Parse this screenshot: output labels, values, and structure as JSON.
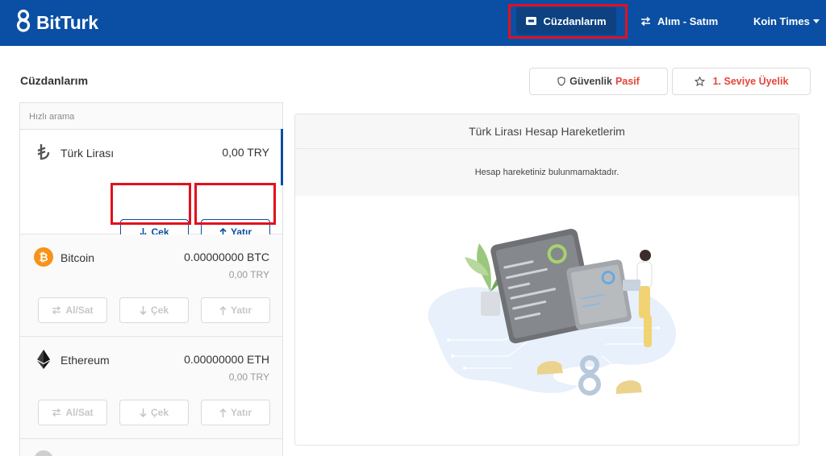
{
  "app": {
    "name": "BitTurk"
  },
  "nav": {
    "wallets": "Cüzdanlarım",
    "trade": "Alım - Satım",
    "koin_times": "Koin Times"
  },
  "page": {
    "title": "Cüzdanlarım",
    "security_label": "Güvenlik",
    "security_status": "Pasif",
    "level_label": "1. Seviye Üyelik"
  },
  "wallets": {
    "search_placeholder": "Hızlı arama",
    "items": [
      {
        "name": "Türk Lirası",
        "balance": "0,00 TRY",
        "sub": "",
        "withdraw": "Çek",
        "deposit": "Yatır",
        "trade": ""
      },
      {
        "name": "Bitcoin",
        "balance": "0.00000000 BTC",
        "sub": "0,00 TRY",
        "withdraw": "Çek",
        "deposit": "Yatır",
        "trade": "Al/Sat"
      },
      {
        "name": "Ethereum",
        "balance": "0.00000000 ETH",
        "sub": "0,00 TRY",
        "withdraw": "Çek",
        "deposit": "Yatır",
        "trade": "Al/Sat"
      }
    ]
  },
  "history": {
    "title": "Türk Lirası Hesap Hareketlerim",
    "empty_message": "Hesap hareketiniz bulunmamaktadır."
  },
  "colors": {
    "brand": "#0a4fa3",
    "highlight": "#e3101e",
    "bitcoin": "#f7931a",
    "accent_red": "#e5453a"
  },
  "icons": {
    "logo": "bitturk-logo-icon",
    "wallet": "wallet-icon",
    "transfer": "swap-arrows-icon",
    "shield": "shield-icon",
    "star": "star-icon",
    "lira": "lira-icon",
    "bitcoin": "bitcoin-icon",
    "ethereum": "ethereum-icon"
  }
}
